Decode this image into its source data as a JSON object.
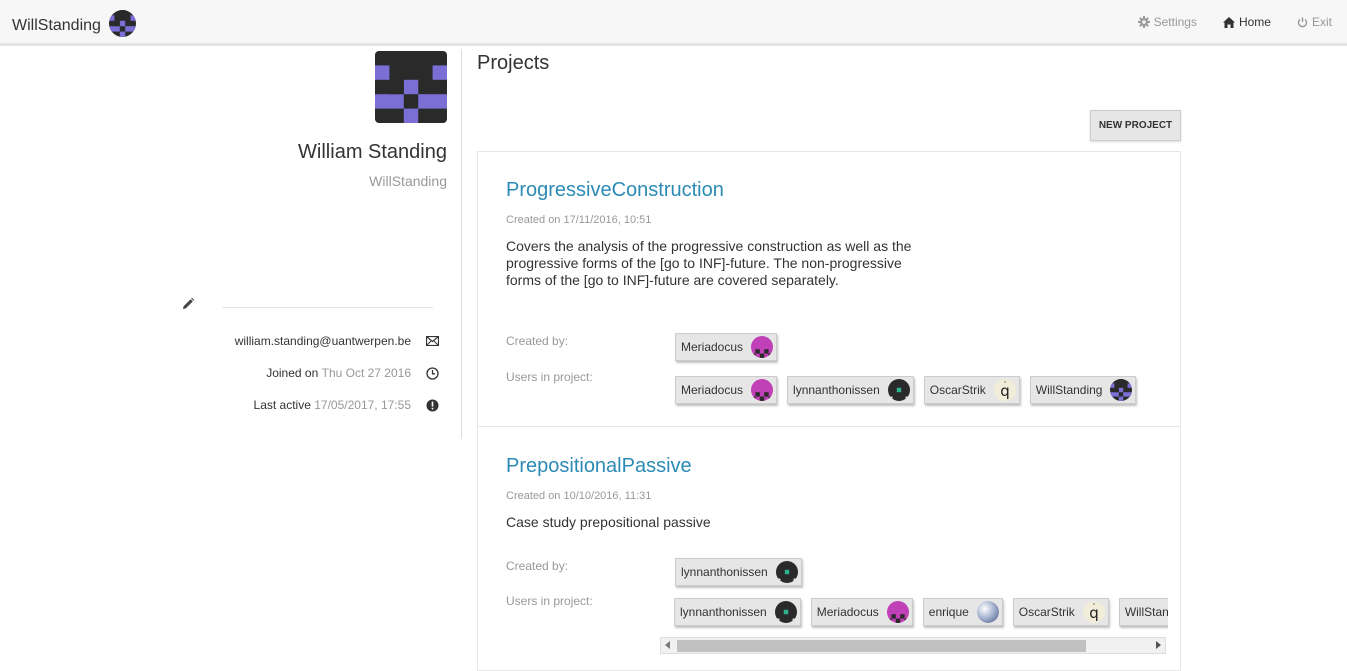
{
  "navbar": {
    "brand": "WillStanding",
    "settings": "Settings",
    "home": "Home",
    "exit": "Exit"
  },
  "profile": {
    "full_name": "William Standing",
    "username": "WillStanding",
    "email": "william.standing@uantwerpen.be",
    "joined_label": "Joined on",
    "joined_value": "Thu Oct 27 2016",
    "active_label": "Last active",
    "active_value": "17/05/2017, 17:55"
  },
  "projects": {
    "title": "Projects",
    "new_button": "NEW PROJECT",
    "created_by_label": "Created by:",
    "users_label": "Users in project:",
    "items": [
      {
        "name": "ProgressiveConstruction",
        "created": "Created on 17/11/2016, 10:51",
        "description": "Covers the analysis of the progressive construction as well as the progressive forms of the [go to INF]-future. The non-progressive forms of the [go to INF]-future are covered separately.",
        "created_by": "Meriadocus",
        "users": [
          "Meriadocus",
          "lynnanthonissen",
          "OscarStrik",
          "WillStanding"
        ]
      },
      {
        "name": "PrepositionalPassive",
        "created": "Created on 10/10/2016, 11:31",
        "description": "Case study prepositional passive",
        "created_by": "lynnanthonissen",
        "users": [
          "lynnanthonissen",
          "Meriadocus",
          "enrique",
          "OscarStrik",
          "WillStanding"
        ]
      }
    ]
  },
  "colors": {
    "link": "#2b8bb5",
    "avatar_purple": "#7b6fd6",
    "avatar_magenta": "#c040b8",
    "avatar_teal": "#2fb38d"
  }
}
